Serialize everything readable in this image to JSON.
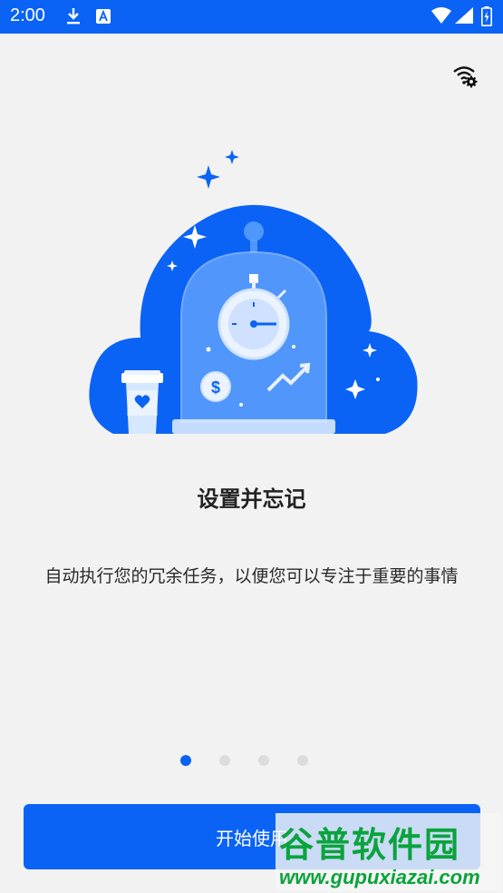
{
  "status_bar": {
    "time": "2:00"
  },
  "onboarding": {
    "title": "设置并忘记",
    "description": "自动执行您的冗余任务，以便您可以专注于重要的事情",
    "start_button_label": "开始使用",
    "page_count": 4,
    "active_page": 1
  },
  "watermark": {
    "title": "谷普软件园",
    "url": "www.gupuxiazai.com"
  },
  "colors": {
    "accent": "#0a63f4",
    "background": "#f2f2f2",
    "watermark": "#0aa33c"
  }
}
